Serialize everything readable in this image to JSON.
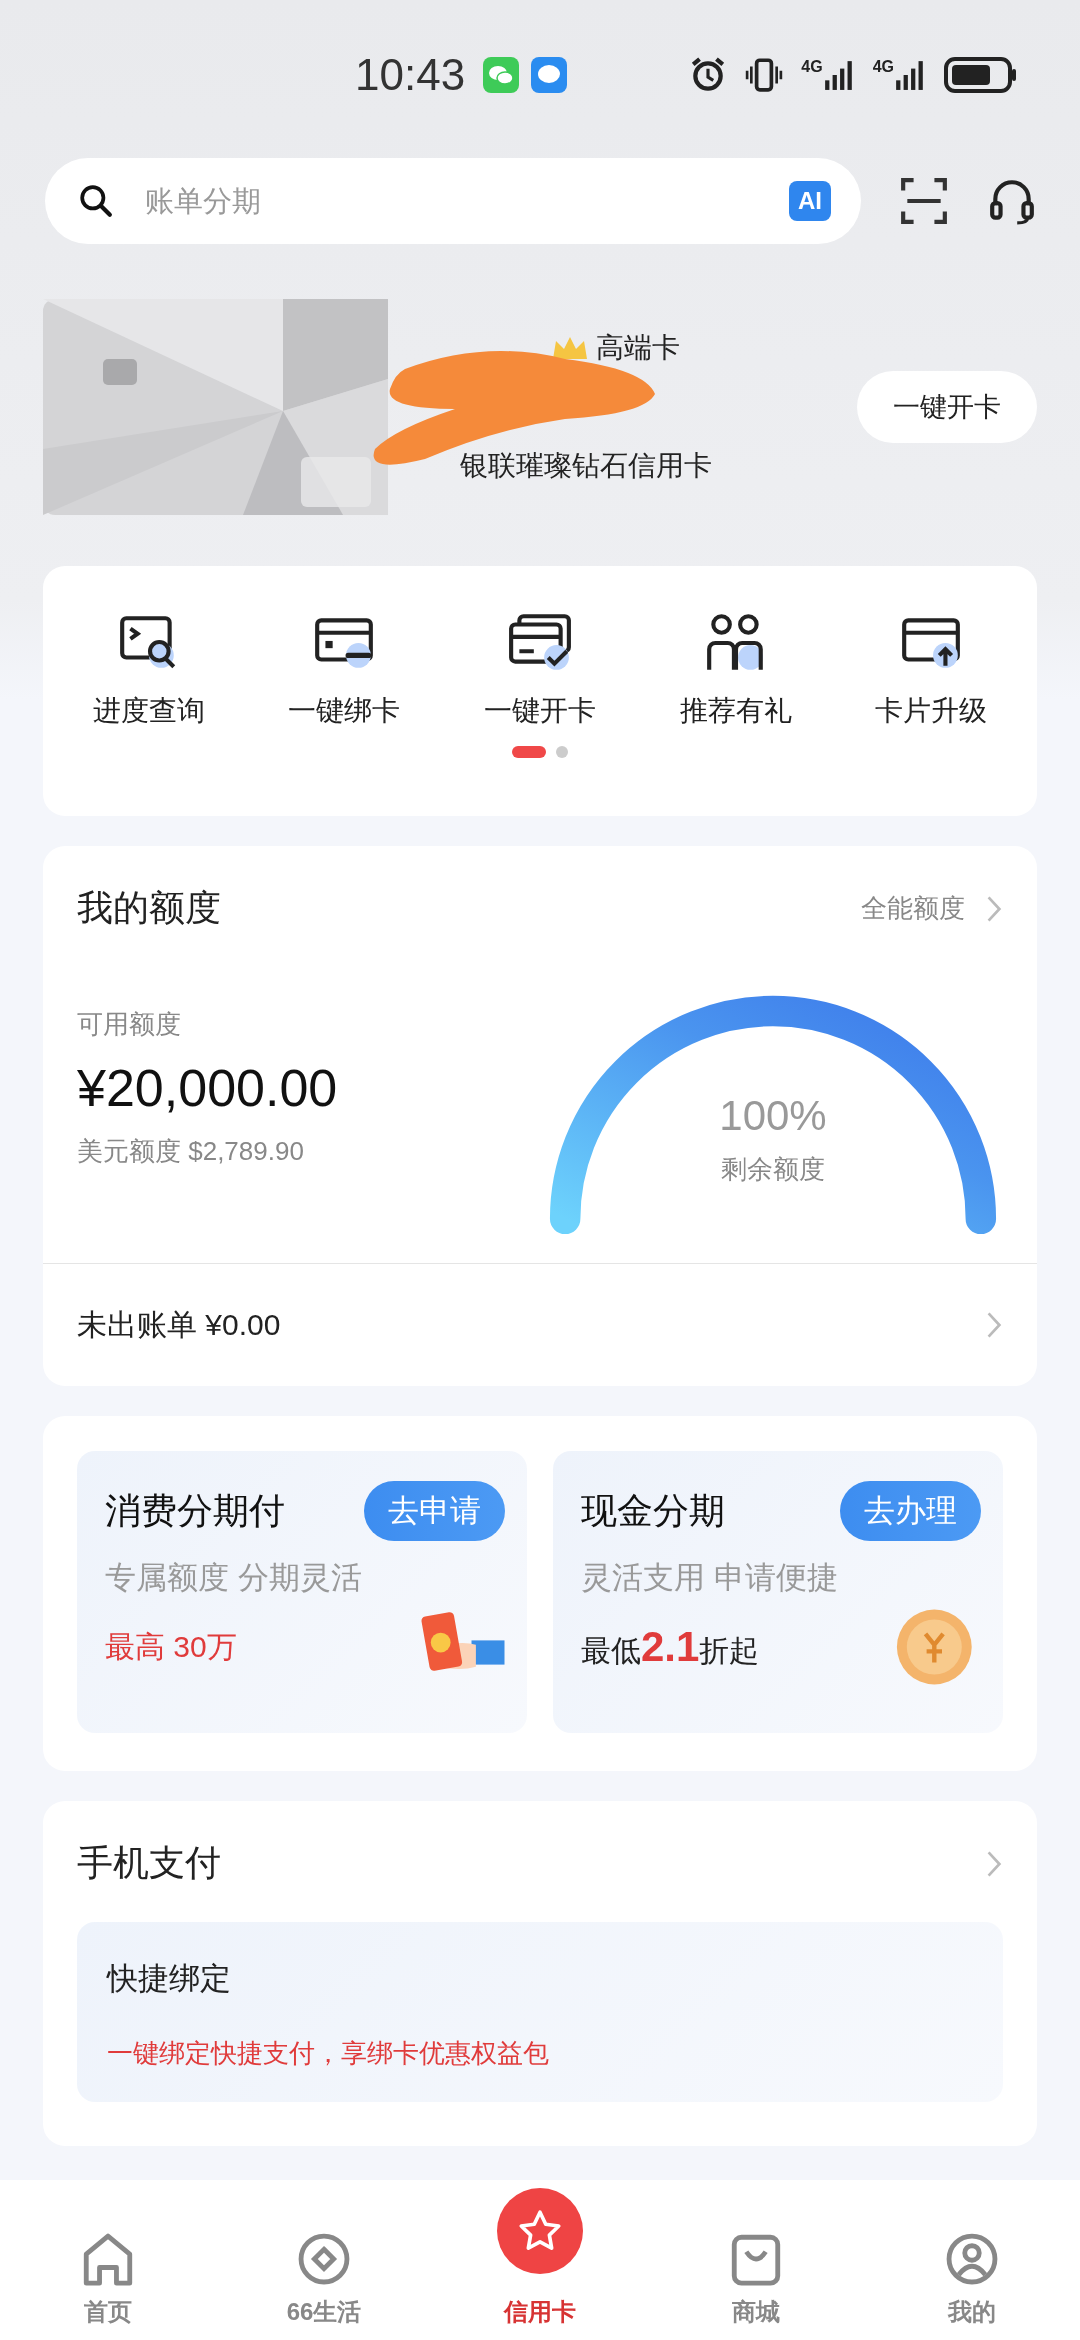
{
  "status_bar": {
    "time": "10:43",
    "networks": [
      "4G",
      "4G"
    ]
  },
  "search": {
    "placeholder": "账单分期",
    "ai_badge": "AI"
  },
  "card": {
    "tier": "高端卡",
    "name": "银联璀璨钻石信用卡",
    "button": "一键开卡"
  },
  "quick_actions": [
    {
      "label": "进度查询"
    },
    {
      "label": "一键绑卡"
    },
    {
      "label": "一键开卡"
    },
    {
      "label": "推荐有礼"
    },
    {
      "label": "卡片升级"
    }
  ],
  "pager": [
    {
      "selected": true
    },
    {
      "selected": false
    }
  ],
  "quota": {
    "title": "我的额度",
    "link": "全能额度",
    "available_label": "可用额度",
    "available": "¥20,000.00",
    "usd": "美元额度 $2,789.90",
    "percent": "100%",
    "gauge_label": "剩余额度",
    "unbilled": "未出账单 ¥0.00"
  },
  "installments": [
    {
      "title": "消费分期付",
      "button": "去申请",
      "subtitle": "专属额度 分期灵活",
      "note": "最高 30万",
      "note_red": true
    },
    {
      "title": "现金分期",
      "button": "去办理",
      "subtitle": "灵活支用 申请便捷",
      "note": "最低**2.1**折起",
      "note_red": false
    }
  ],
  "mobile_pay": {
    "title": "手机支付",
    "item_title": "快捷绑定",
    "item_text": "一键绑定快捷支付，享绑卡优惠权益包"
  },
  "nav": [
    {
      "label": "首页",
      "selected": false
    },
    {
      "label": "66生活",
      "selected": false
    },
    {
      "label": "信用卡",
      "selected": true
    },
    {
      "label": "商城",
      "selected": false
    },
    {
      "label": "我的",
      "selected": false
    }
  ]
}
